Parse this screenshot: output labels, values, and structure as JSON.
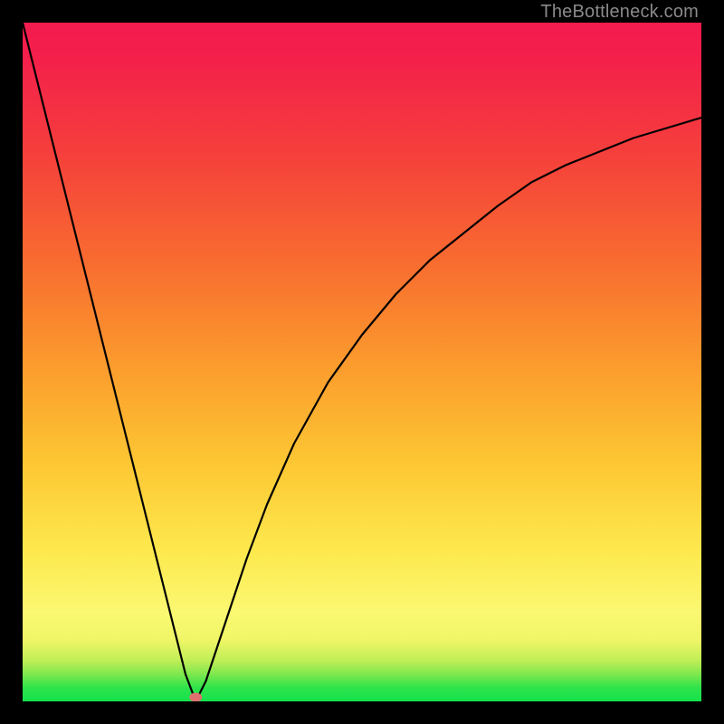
{
  "watermark": "TheBottleneck.com",
  "chart_data": {
    "type": "line",
    "title": "",
    "xlabel": "",
    "ylabel": "",
    "xlim": [
      0,
      100
    ],
    "ylim": [
      0,
      100
    ],
    "grid": false,
    "legend": false,
    "gradient_bands": [
      {
        "y0": 0,
        "y1": 3,
        "color": "#13e24d"
      },
      {
        "y0": 3,
        "y1": 6,
        "color": "#7ce84c"
      },
      {
        "y0": 6,
        "y1": 9,
        "color": "#c8ed57"
      },
      {
        "y0": 9,
        "y1": 15,
        "color": "#f5f773"
      },
      {
        "y0": 15,
        "y1": 30,
        "color": "#fde94e"
      },
      {
        "y0": 30,
        "y1": 45,
        "color": "#fdbf33"
      },
      {
        "y0": 45,
        "y1": 60,
        "color": "#fa8f2f"
      },
      {
        "y0": 60,
        "y1": 75,
        "color": "#f75e33"
      },
      {
        "y0": 75,
        "y1": 90,
        "color": "#f43641"
      },
      {
        "y0": 90,
        "y1": 100,
        "color": "#f41b4e"
      }
    ],
    "series": [
      {
        "name": "bottleneck-curve",
        "x": [
          0,
          5,
          10,
          15,
          20,
          24,
          25.5,
          27,
          30,
          33,
          36,
          40,
          45,
          50,
          55,
          60,
          65,
          70,
          75,
          80,
          85,
          90,
          95,
          100
        ],
        "y": [
          100,
          80,
          60,
          40,
          20,
          4,
          0,
          3,
          12,
          21,
          29,
          38,
          47,
          54,
          60,
          65,
          69,
          73,
          76.5,
          79,
          81,
          83,
          84.5,
          86
        ]
      }
    ],
    "marker": {
      "x": 25.5,
      "y": 0.6,
      "color": "#e06f6f",
      "rx": 7,
      "ry": 5
    }
  }
}
